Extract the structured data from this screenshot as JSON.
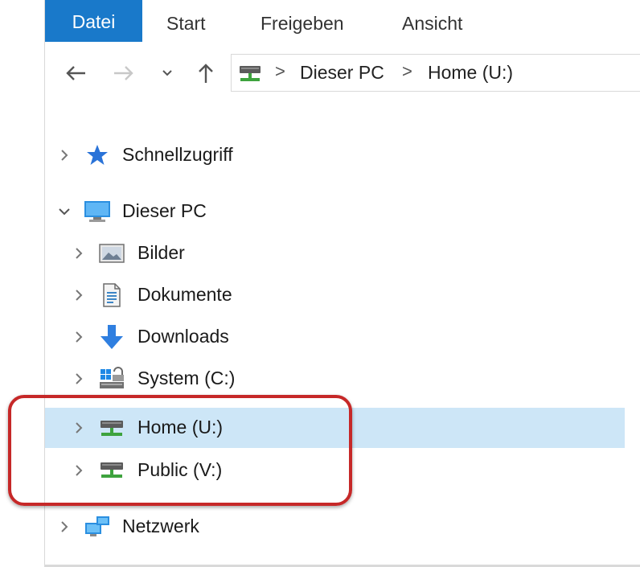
{
  "ribbon": {
    "tabs": [
      "Datei",
      "Start",
      "Freigeben",
      "Ansicht"
    ]
  },
  "address_bar": {
    "path": [
      "Dieser PC",
      "Home (U:)"
    ],
    "separator": ">"
  },
  "tree": {
    "quick_access": "Schnellzugriff",
    "this_pc": "Dieser PC",
    "pictures": "Bilder",
    "documents": "Dokumente",
    "downloads": "Downloads",
    "system": "System (C:)",
    "home": "Home (U:)",
    "public": "Public (V:)",
    "network": "Netzwerk"
  },
  "colors": {
    "file_tab": "#1979ca",
    "selection": "#cde6f7",
    "highlight_border": "#c62828"
  }
}
